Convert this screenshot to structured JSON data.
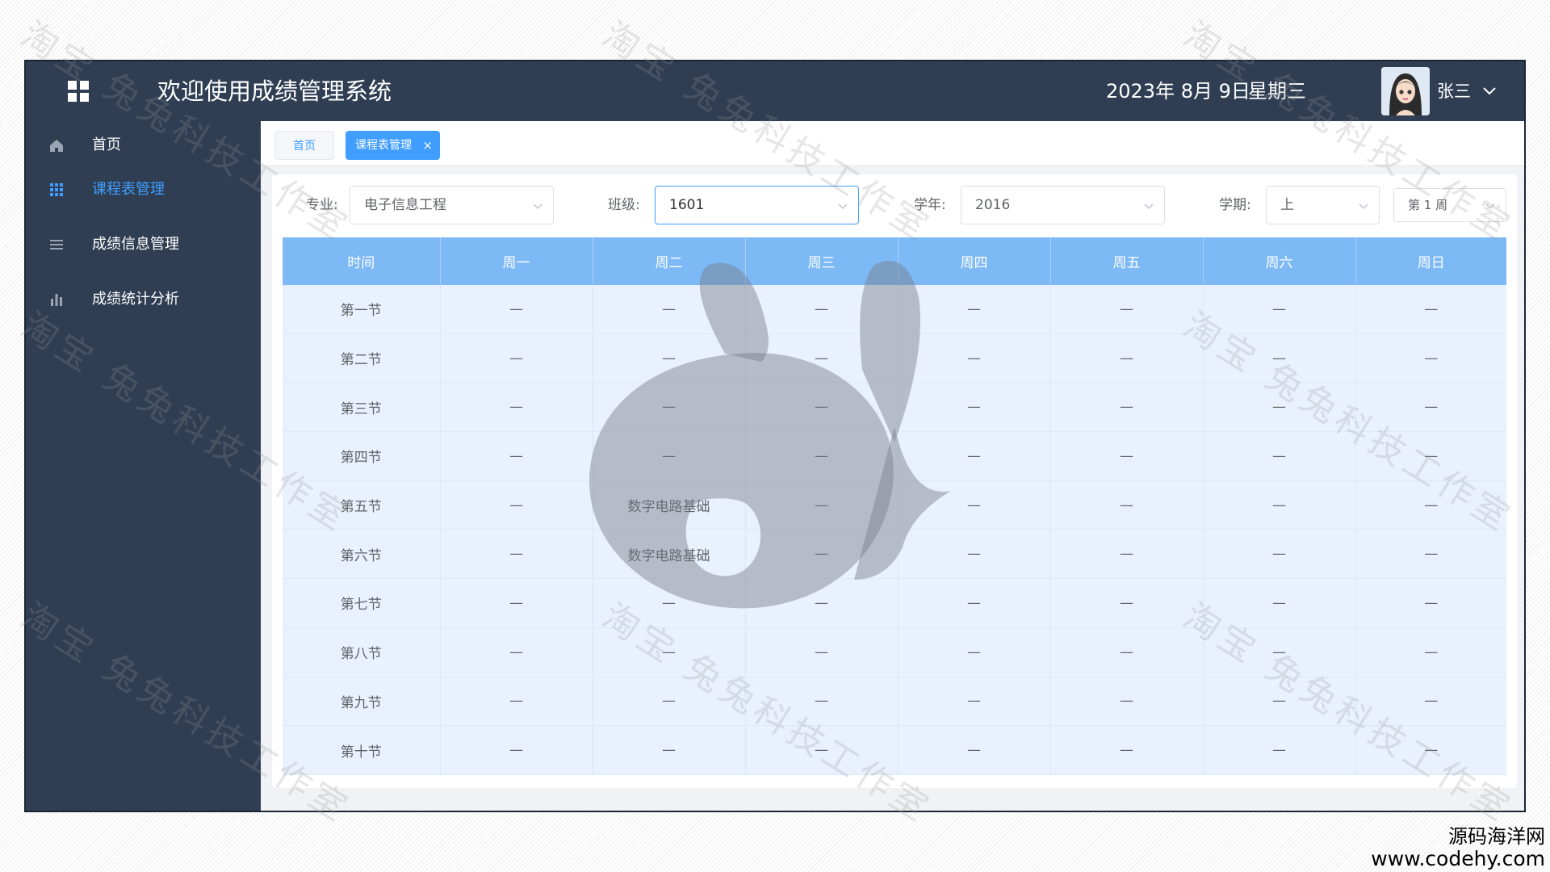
{
  "header": {
    "title": "欢迎使用成绩管理系统",
    "date": "2023年 8月 9日",
    "weekday": "星期三",
    "username": "张三"
  },
  "sidebar": {
    "items": [
      {
        "label": "首页",
        "icon": "home-icon",
        "active": false
      },
      {
        "label": "课程表管理",
        "icon": "grid-icon",
        "active": true
      },
      {
        "label": "成绩信息管理",
        "icon": "list-icon",
        "active": false
      },
      {
        "label": "成绩统计分析",
        "icon": "bar-chart-icon",
        "active": false
      }
    ]
  },
  "tabs": [
    {
      "label": "首页",
      "active": false
    },
    {
      "label": "课程表管理",
      "active": true,
      "close": "×"
    }
  ],
  "filters": {
    "major": {
      "label": "专业:",
      "value": "电子信息工程"
    },
    "class": {
      "label": "班级:",
      "value": "1601"
    },
    "year": {
      "label": "学年:",
      "value": "2016"
    },
    "term": {
      "label": "学期:",
      "value": "上"
    },
    "week": {
      "value": "第 1 周"
    }
  },
  "schedule": {
    "headers": [
      "时间",
      "周一",
      "周二",
      "周三",
      "周四",
      "周五",
      "周六",
      "周日"
    ],
    "rows": [
      [
        "第一节",
        "—",
        "—",
        "—",
        "—",
        "—",
        "—",
        "—"
      ],
      [
        "第二节",
        "—",
        "—",
        "—",
        "—",
        "—",
        "—",
        "—"
      ],
      [
        "第三节",
        "—",
        "—",
        "—",
        "—",
        "—",
        "—",
        "—"
      ],
      [
        "第四节",
        "—",
        "—",
        "—",
        "—",
        "—",
        "—",
        "—"
      ],
      [
        "第五节",
        "—",
        "数字电路基础",
        "—",
        "—",
        "—",
        "—",
        "—"
      ],
      [
        "第六节",
        "—",
        "数字电路基础",
        "—",
        "—",
        "—",
        "—",
        "—"
      ],
      [
        "第七节",
        "—",
        "—",
        "—",
        "—",
        "—",
        "—",
        "—"
      ],
      [
        "第八节",
        "—",
        "—",
        "—",
        "—",
        "—",
        "—",
        "—"
      ],
      [
        "第九节",
        "—",
        "—",
        "—",
        "—",
        "—",
        "—",
        "—"
      ],
      [
        "第十节",
        "—",
        "—",
        "—",
        "—",
        "—",
        "—",
        "—"
      ]
    ]
  },
  "watermark": {
    "text": "淘宝 兔兔科技工作室"
  },
  "branding": {
    "name": "源码海洋网",
    "url": "www.codehy.com"
  },
  "colors": {
    "header_bg": "#2f3e53",
    "accent": "#409eff",
    "table_header": "#7db9f5",
    "table_body": "#e8f1fd"
  }
}
